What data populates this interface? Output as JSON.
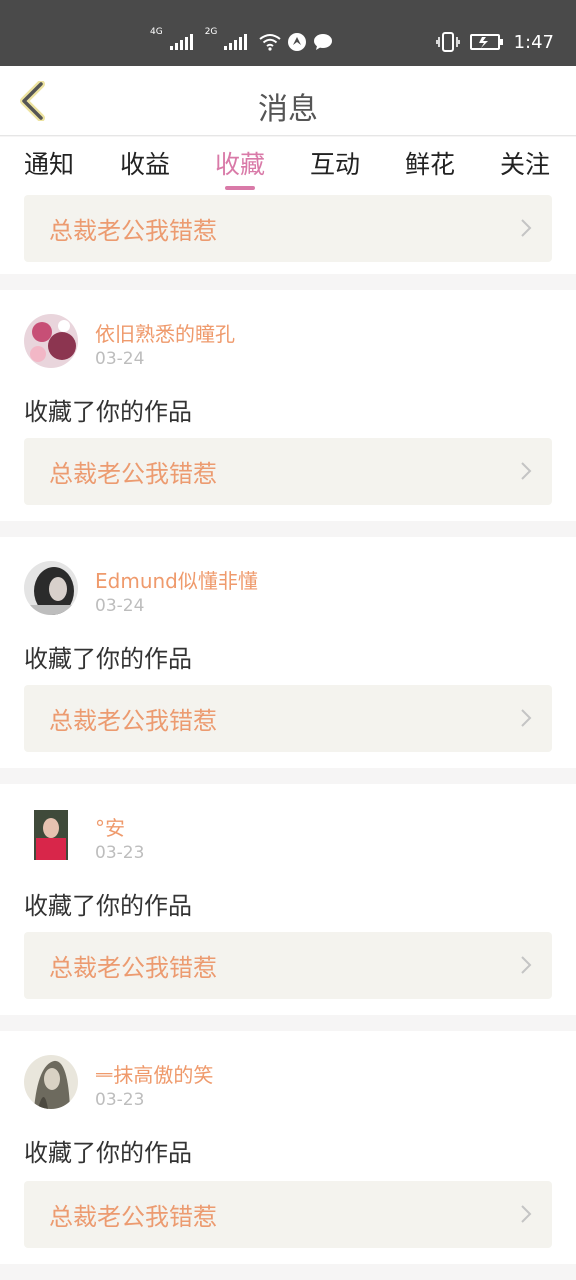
{
  "status_bar": {
    "net1": "4G",
    "net2": "2G",
    "time": "1:47"
  },
  "header": {
    "title": "消息"
  },
  "tabs": [
    {
      "label": "通知"
    },
    {
      "label": "收益"
    },
    {
      "label": "收藏"
    },
    {
      "label": "互动"
    },
    {
      "label": "鲜花"
    },
    {
      "label": "关注"
    }
  ],
  "active_tab": "收藏",
  "colors": {
    "accent": "#d97aa8",
    "username": "#ef9a6c",
    "work_title": "#ec9b70",
    "work_bg": "#f4f3ee"
  },
  "partial_item": {
    "work_title": "总裁老公我错惹"
  },
  "items": [
    {
      "username": "依旧熟悉的瞳孔",
      "date": "03-24",
      "action": "收藏了你的作品",
      "work_title": "总裁老公我错惹"
    },
    {
      "username": "Edmund似懂非懂",
      "date": "03-24",
      "action": "收藏了你的作品",
      "work_title": "总裁老公我错惹"
    },
    {
      "username": "°安",
      "date": "03-23",
      "action": "收藏了你的作品",
      "work_title": "总裁老公我错惹"
    },
    {
      "username": "ᆖ抹高傲的笑",
      "date": "03-23",
      "action": "收藏了你的作品",
      "work_title": "总裁老公我错惹"
    }
  ]
}
